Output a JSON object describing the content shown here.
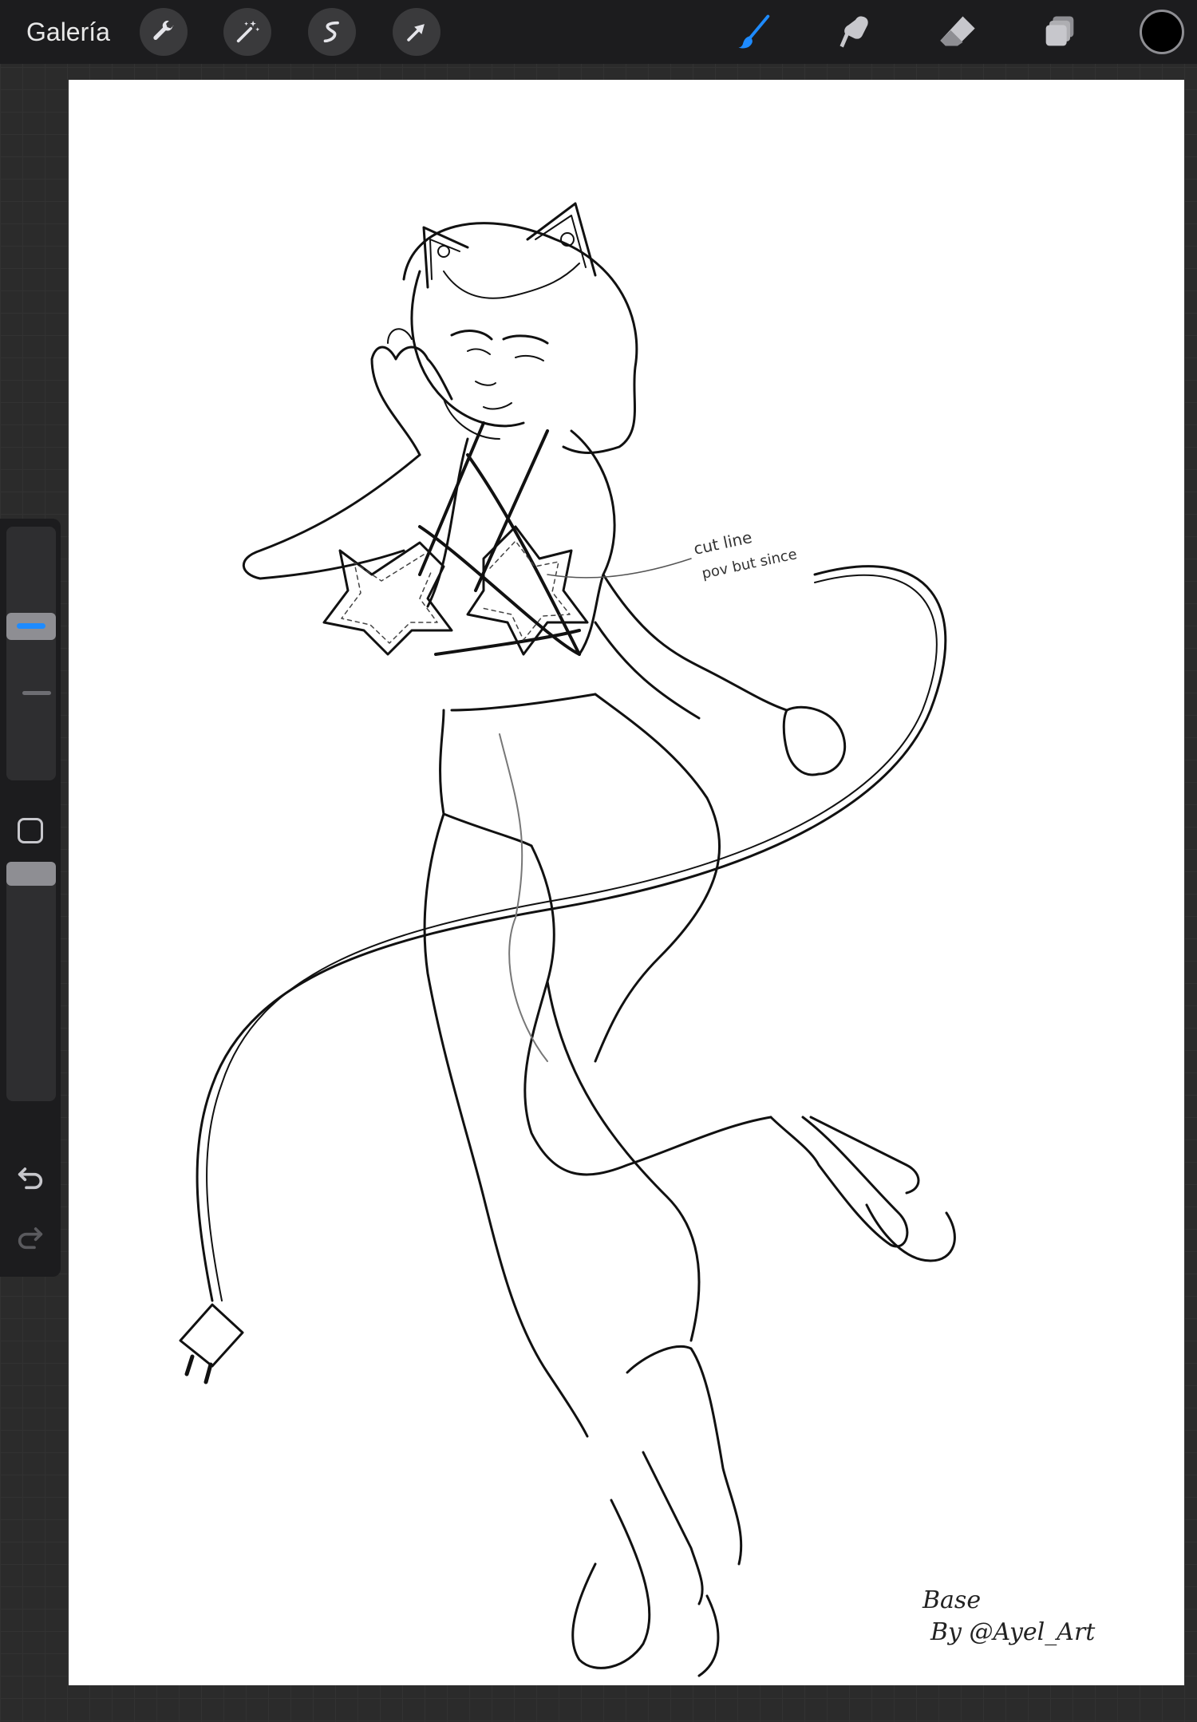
{
  "topbar": {
    "gallery_label": "Galería",
    "actions_left": [
      "wrench-icon",
      "magic-wand-icon",
      "selection-icon",
      "transform-arrow-icon"
    ],
    "tools_right": [
      "brush-icon",
      "smudge-icon",
      "eraser-icon",
      "layers-icon"
    ],
    "active_tool": "brush-icon",
    "active_color": "#000000",
    "accent_color": "#1e8bff"
  },
  "sidebar": {
    "brush_size_level": 0.62,
    "opacity_level": 1.0,
    "undo_icon": "undo-icon",
    "redo_icon": "redo-icon",
    "modify_icon": "square-modify-icon"
  },
  "canvas": {
    "background": "#ffffff",
    "note_text_line1": "cut line",
    "note_text_line2": "pov but since",
    "signature_line1": "Base",
    "signature_line2": "By @Ayel_Art"
  }
}
